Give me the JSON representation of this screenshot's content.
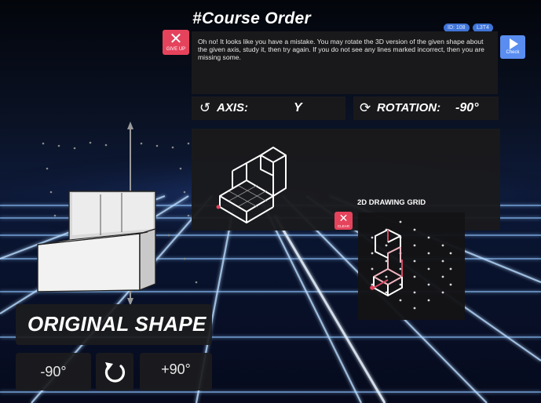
{
  "header": {
    "title": "#Course Order",
    "badges": [
      "ID: 108",
      "L3T4"
    ]
  },
  "message": "Oh no! It looks like you have a mistake. You may rotate the 3D version of the given shape about the given axis, study it, then try again. If you do not see any lines marked incorrect, then you are missing some.",
  "give_up": {
    "icon": "close-icon",
    "label": "GIVE UP"
  },
  "check": {
    "icon": "play-icon",
    "label": "Check"
  },
  "axis": {
    "icon": "rotate-icon",
    "label": "AXIS:",
    "value": "Y"
  },
  "rotation": {
    "icon": "sync-icon",
    "label": "ROTATION:",
    "value": "-90°"
  },
  "grid": {
    "title": "2D DRAWING GRID",
    "close_icon": "close-icon",
    "close_label": "CLEAR"
  },
  "original_shape_label": "ORIGINAL SHAPE",
  "controls": {
    "minus": "-90°",
    "reset_icon": "reset-icon",
    "plus": "+90°"
  },
  "colors": {
    "accent_red": "#e5435c",
    "accent_blue": "#5a8df0",
    "badge_blue": "#3f74d8",
    "grid_glow": "#cfe6ff"
  }
}
